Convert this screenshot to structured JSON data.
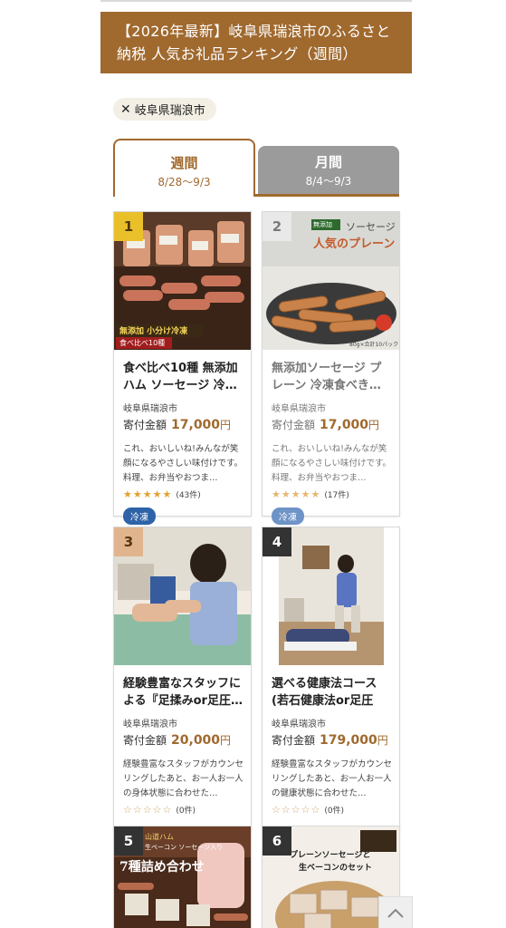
{
  "banner": {
    "title": "【2026年最新】岐阜県瑞浪市のふるさと納税 人気お礼品ランキング（週間）"
  },
  "filter_chip": {
    "close_icon": "✕",
    "label": "岐阜県瑞浪市"
  },
  "tabs": [
    {
      "label": "週間",
      "range": "8/28〜9/3",
      "active": true
    },
    {
      "label": "月間",
      "range": "8/4〜9/3",
      "active": false
    }
  ],
  "items": [
    {
      "rank": "1",
      "title": "食べ比べ10種 無添加ハム ソーセージ 冷…",
      "municipality": "岐阜県瑞浪市",
      "amount_label": "寄付金額",
      "amount": "17,000",
      "yen": "円",
      "description": "これ、おいしいね!みんなが笑顔になるやさしい味付けです。料理、お弁当やおつま…",
      "stars": "★★★★★",
      "review_count": "(43件)",
      "badge": "冷凍",
      "image_text": [
        "無添加 小分け冷凍",
        "食べ比べ10種"
      ]
    },
    {
      "rank": "2",
      "title": "無添加ソーセージ プレーン 冷凍食べき…",
      "municipality": "岐阜県瑞浪市",
      "amount_label": "寄付金額",
      "amount": "17,000",
      "yen": "円",
      "description": "これ、おいしいね!みんなが笑顔になるやさしい味付けです。料理、お弁当やおつま…",
      "stars": "★★★★★",
      "review_count": "(17件)",
      "badge": "冷凍",
      "image_text": [
        "無添加",
        "ソーセージ",
        "人気のプレーン",
        "80g×合計10パック"
      ]
    },
    {
      "rank": "3",
      "title": "経験豊富なスタッフによる『足揉みor足圧…",
      "municipality": "岐阜県瑞浪市",
      "amount_label": "寄付金額",
      "amount": "20,000",
      "yen": "円",
      "description": "経験豊富なスタッフがカウンセリングしたあと、お一人お一人の身体状態に合わせた…",
      "stars": "☆☆☆☆☆",
      "review_count": "(0件)"
    },
    {
      "rank": "4",
      "title": "選べる健康法コース(若石健康法or足圧健…",
      "municipality": "岐阜県瑞浪市",
      "amount_label": "寄付金額",
      "amount": "179,000",
      "yen": "円",
      "description": "経験豊富なスタッフがカウンセリングしたあと、お一人お一人の健康状態に合わせた…",
      "stars": "☆☆☆☆☆",
      "review_count": "(0件)"
    },
    {
      "rank": "5",
      "image_text": [
        "山道ハム",
        "生ベーコン ソーセージ入り",
        "7種詰め合わせ"
      ]
    },
    {
      "rank": "6",
      "image_text": [
        "プレーンソーセージと",
        "生ベーコンのセット"
      ]
    }
  ],
  "scroll_top": {
    "icon": "chevron-up-icon"
  }
}
